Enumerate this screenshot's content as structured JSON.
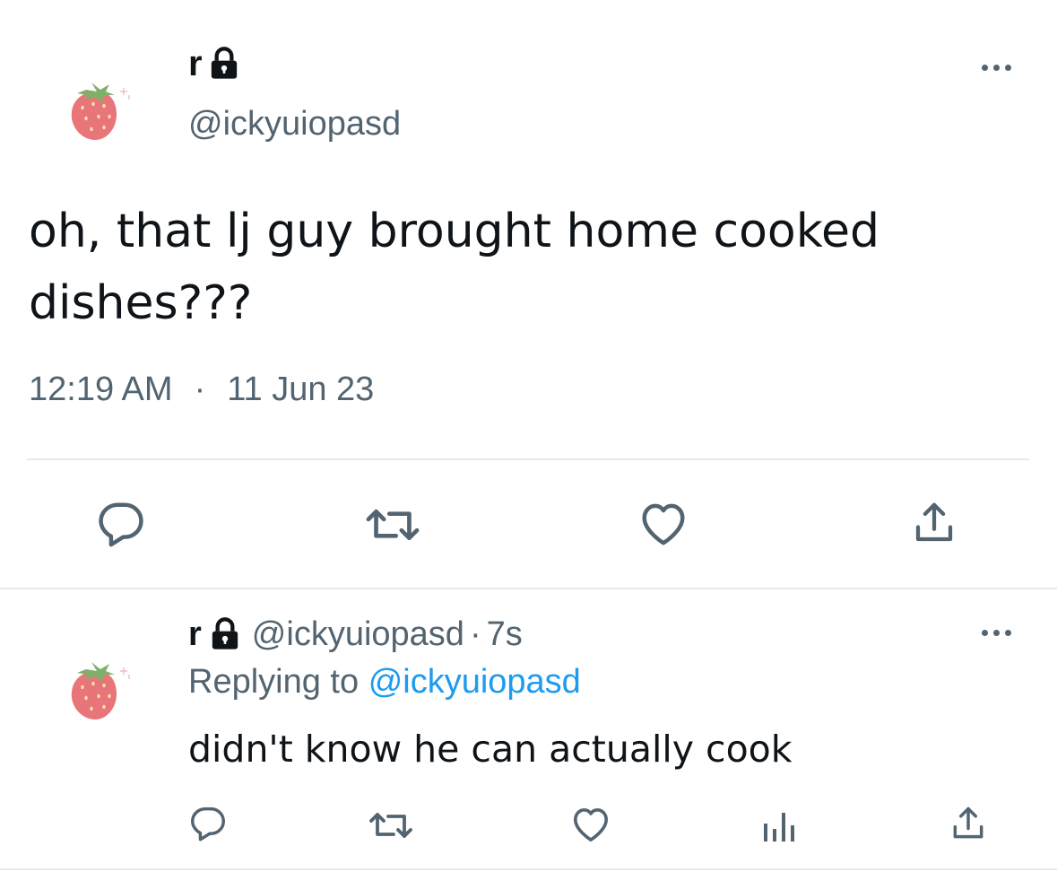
{
  "main_tweet": {
    "display_name": "r",
    "handle": "@ickyuiopasd",
    "text_line1": "oh, that lj guy brought home cooked",
    "text_line2": "dishes???",
    "time": "12:19 AM",
    "separator": "·",
    "date": "11 Jun 23",
    "actions": [
      "reply-icon",
      "retweet-icon",
      "like-icon",
      "share-icon"
    ]
  },
  "reply_tweet": {
    "display_name": "r",
    "handle": "@ickyuiopasd",
    "separator": "·",
    "age": "7s",
    "replying_prefix": "Replying to",
    "replying_handle": "@ickyuiopasd",
    "text": "didn't know he can actually cook",
    "actions": [
      "reply-icon",
      "retweet-icon",
      "like-icon",
      "views-icon",
      "share-icon"
    ]
  },
  "colors": {
    "text_primary": "#0f1419",
    "text_secondary": "#536471",
    "link": "#1d9bf0",
    "divider": "#e6e9eb"
  }
}
